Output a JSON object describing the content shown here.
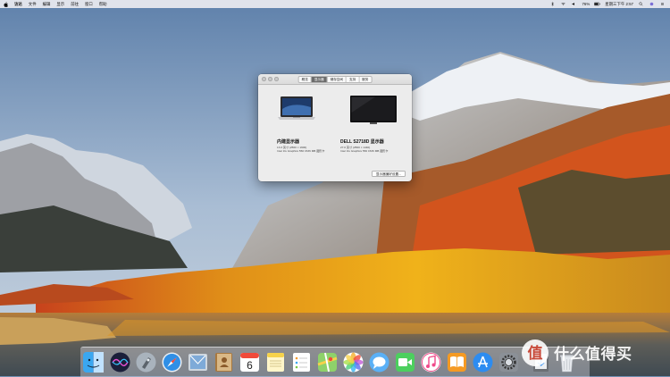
{
  "menubar": {
    "items": [
      "访达",
      "文件",
      "编辑",
      "显示",
      "前往",
      "窗口",
      "帮助"
    ],
    "battery": "76%",
    "clock": "星期三下午 2:57"
  },
  "window": {
    "tabs": [
      "概览",
      "显示器",
      "储存空间",
      "支持",
      "服务"
    ],
    "active_tab": "显示器",
    "displays": [
      {
        "name": "内建显示器",
        "size_line": "13.3 英寸 (2560 × 1600)",
        "gpu_line": "Intel Iris Graphics 550 1536 MB 图形卡"
      },
      {
        "name": "DELL S2718D 显示器",
        "size_line": "27.0 英寸 (2560 × 1440)",
        "gpu_line": "Intel Iris Graphics 550 1536 MB 图形卡"
      }
    ],
    "button": "显示器偏好设置..."
  },
  "dock": {
    "apps": [
      "finder-icon",
      "siri-icon",
      "launchpad-icon",
      "safari-icon",
      "mail-icon",
      "contacts-icon",
      "calendar-icon",
      "notes-icon",
      "reminders-icon",
      "maps-icon",
      "photos-icon",
      "messages-icon",
      "facetime-icon",
      "music-icon",
      "books-icon",
      "app-store-icon",
      "system-preferences-icon",
      "downloads-icon",
      "trash-icon"
    ],
    "calendar_day": "6"
  },
  "watermark": {
    "text": "什么值得买"
  },
  "colors": {
    "accent": "#6c6c6c",
    "menubar": "#ebebf0"
  }
}
